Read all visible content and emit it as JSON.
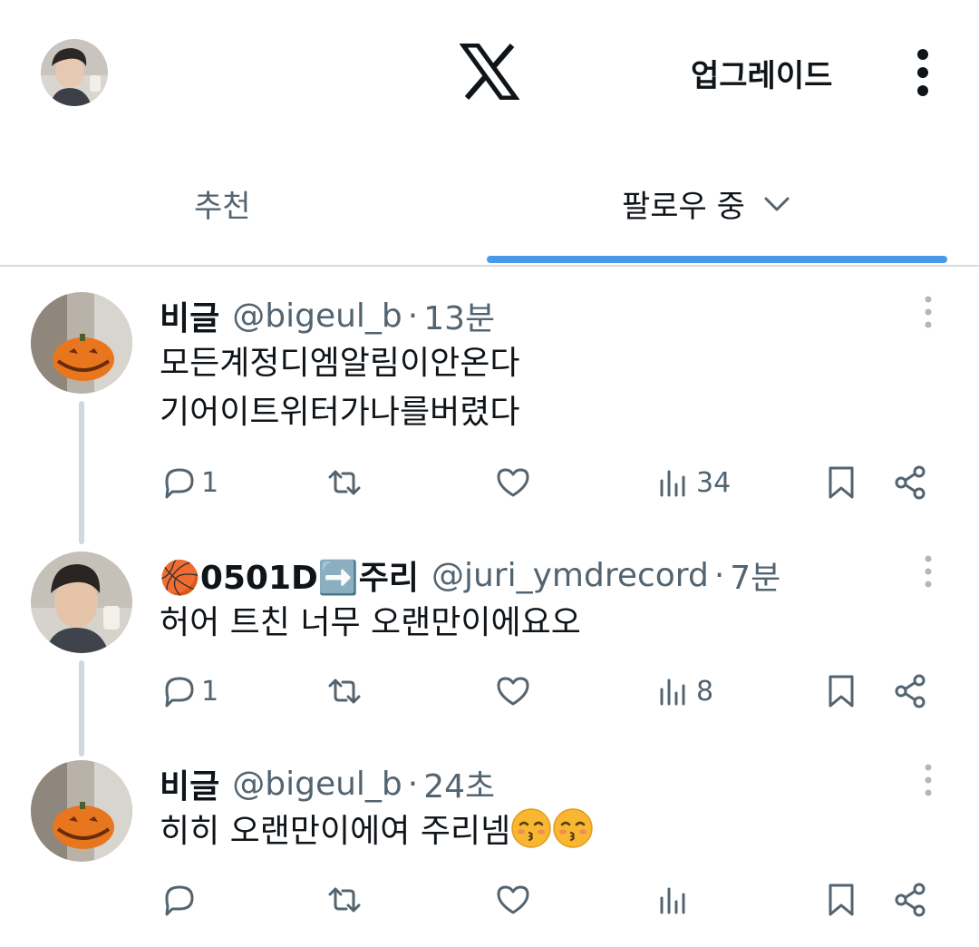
{
  "header": {
    "upgrade_label": "업그레이드",
    "logo_icon": "x-logo-icon",
    "more_icon": "more-vertical-icon"
  },
  "tabs": [
    {
      "label": "추천",
      "active": false
    },
    {
      "label": "팔로우 중",
      "active": true
    }
  ],
  "colors": {
    "accent": "#4a99e9",
    "text_primary": "#0f1419",
    "text_secondary": "#536471",
    "thread_line": "#cfd9de"
  },
  "posts": [
    {
      "name": "비글",
      "handle": "@bigeul_b",
      "separator": "·",
      "time": "13분",
      "lines": [
        "모든계정디엠알림이안온다",
        "기어이트위터가나를버렸다"
      ],
      "reply_count": "1",
      "retweet_count": "",
      "like_count": "",
      "view_count": "34"
    },
    {
      "name_prefix": "🏀",
      "name": "0501D",
      "name_arrow": "➡️",
      "name_suffix": "주리",
      "handle": "@juri_ymdrecord",
      "separator": "·",
      "time": "7분",
      "lines": [
        "허어 트친 너무 오랜만이에요오"
      ],
      "reply_count": "1",
      "retweet_count": "",
      "like_count": "",
      "view_count": "8"
    },
    {
      "name": "비글",
      "handle": "@bigeul_b",
      "separator": "·",
      "time": "24초",
      "lines": [
        "히히 오랜만이에여 주리넴"
      ],
      "emoji": "kissing-face-with-closed-eyes",
      "reply_count": "",
      "retweet_count": "",
      "like_count": "",
      "view_count": ""
    }
  ]
}
